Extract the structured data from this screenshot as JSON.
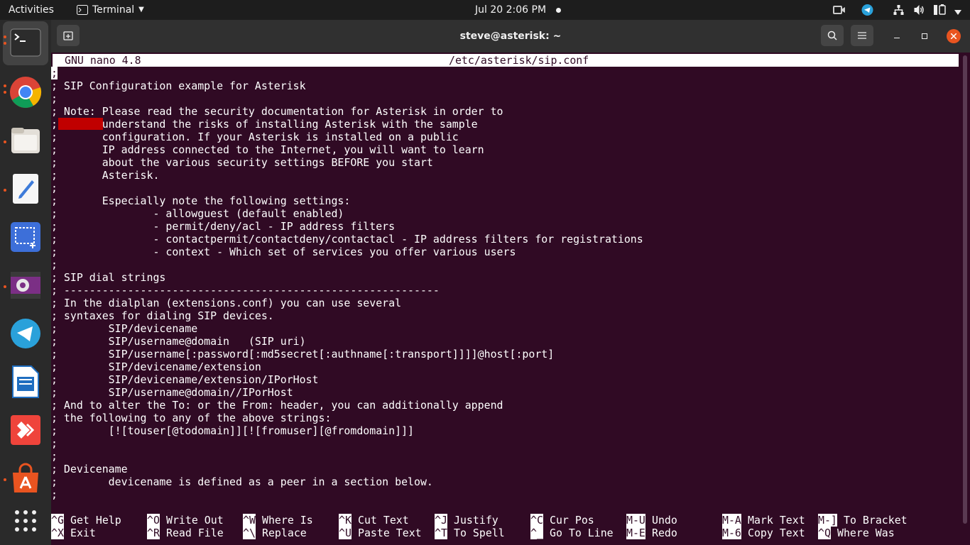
{
  "topbar": {
    "activities": "Activities",
    "app_menu": "Terminal",
    "clock": "Jul 20  2:06 PM"
  },
  "window": {
    "title": "steve@asterisk: ~"
  },
  "dock": {
    "items": [
      "terminal-icon",
      "chrome-icon",
      "files-icon",
      "text-editor-icon",
      "screenshot-icon",
      "video-icon",
      "telegram-icon",
      "writer-icon",
      "anydesk-icon",
      "app-store-icon",
      "show-apps-icon"
    ]
  },
  "nano": {
    "version": "GNU nano 4.8",
    "filename": "/etc/asterisk/sip.conf",
    "lines": [
      ";",
      "; SIP Configuration example for Asterisk",
      ";",
      "; Note: Please read the security documentation for Asterisk in order to",
      ";       understand the risks of installing Asterisk with the sample",
      ";       configuration. If your Asterisk is installed on a public",
      ";       IP address connected to the Internet, you will want to learn",
      ";       about the various security settings BEFORE you start",
      ";       Asterisk.",
      ";",
      ";       Especially note the following settings:",
      ";               - allowguest (default enabled)",
      ";               - permit/deny/acl - IP address filters",
      ";               - contactpermit/contactdeny/contactacl - IP address filters for registrations",
      ";               - context - Which set of services you offer various users",
      ";",
      "; SIP dial strings",
      "; -----------------------------------------------------------",
      "; In the dialplan (extensions.conf) you can use several",
      "; syntaxes for dialing SIP devices.",
      ";        SIP/devicename",
      ";        SIP/username@domain   (SIP uri)",
      ";        SIP/username[:password[:md5secret[:authname[:transport]]]]@host[:port]",
      ";        SIP/devicename/extension",
      ";        SIP/devicename/extension/IPorHost",
      ";        SIP/username@domain//IPorHost",
      "; And to alter the To: or the From: header, you can additionally append",
      "; the following to any of the above strings:",
      ";        [![touser[@todomain]][![fromuser][@fromdomain]]]",
      ";",
      ";",
      "; Devicename",
      ";        devicename is defined as a peer in a section below.",
      ";"
    ],
    "shortcuts": [
      {
        "key": "^G",
        "label": "Get Help"
      },
      {
        "key": "^X",
        "label": "Exit"
      },
      {
        "key": "^O",
        "label": "Write Out"
      },
      {
        "key": "^R",
        "label": "Read File"
      },
      {
        "key": "^W",
        "label": "Where Is"
      },
      {
        "key": "^\\",
        "label": "Replace"
      },
      {
        "key": "^K",
        "label": "Cut Text"
      },
      {
        "key": "^U",
        "label": "Paste Text"
      },
      {
        "key": "^J",
        "label": "Justify"
      },
      {
        "key": "^T",
        "label": "To Spell"
      },
      {
        "key": "^C",
        "label": "Cur Pos"
      },
      {
        "key": "^_",
        "label": "Go To Line"
      },
      {
        "key": "M-U",
        "label": "Undo"
      },
      {
        "key": "M-E",
        "label": "Redo"
      },
      {
        "key": "M-A",
        "label": "Mark Text"
      },
      {
        "key": "M-6",
        "label": "Copy Text"
      },
      {
        "key": "M-]",
        "label": "To Bracket"
      },
      {
        "key": "^Q",
        "label": "Where Was"
      }
    ]
  }
}
